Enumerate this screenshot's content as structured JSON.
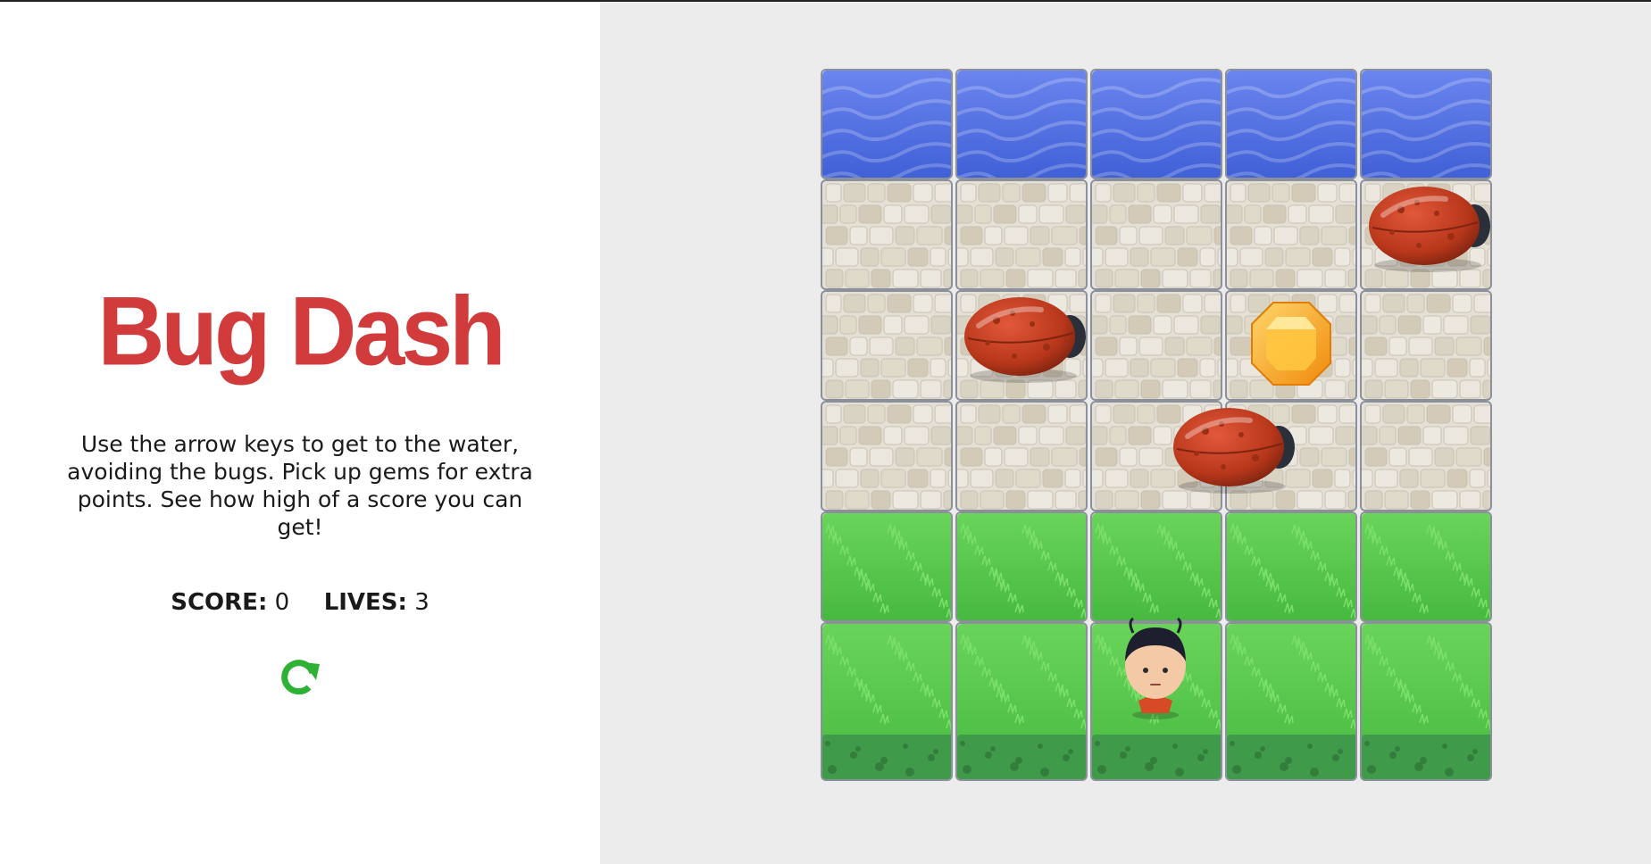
{
  "game": {
    "title": "Bug Dash",
    "instructions": "Use the arrow keys to get to the water, avoiding the bugs. Pick up gems for extra points. See how high of a score you can get!",
    "score_label": "SCORE:",
    "score_value": "0",
    "lives_label": "LIVES:",
    "lives_value": "3",
    "restart_icon": "restart-icon"
  },
  "board": {
    "columns": 5,
    "rows": [
      "water",
      "stone",
      "stone",
      "stone",
      "grass",
      "grass"
    ],
    "bugs": [
      {
        "row": 1,
        "col": 4
      },
      {
        "row": 2,
        "col": 1
      },
      {
        "row": 3,
        "col": 2.55
      }
    ],
    "gem": {
      "row": 2,
      "col": 3,
      "color": "#f6a312"
    },
    "player": {
      "row": 5,
      "col": 2
    }
  },
  "colors": {
    "title": "#d13b3b",
    "restart": "#2eb135",
    "water": "#4f6fe0",
    "stone": "#e4e0d6",
    "grass": "#56c84a",
    "bug": "#c0391c"
  }
}
